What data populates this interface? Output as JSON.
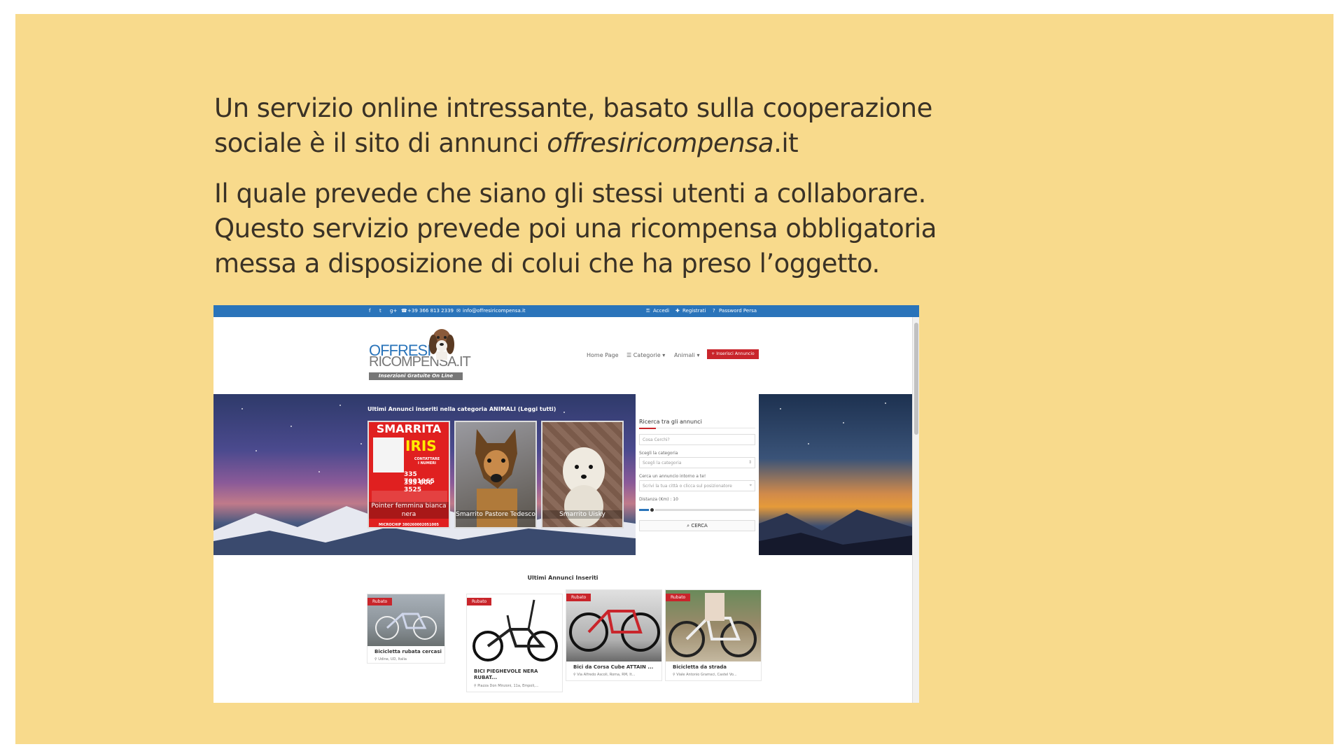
{
  "slide": {
    "p1_line1": "Un servizio online intressante, basato sulla cooperazione",
    "p1_line2_pre": "sociale è il sito di annunci ",
    "p1_line2_em": "offresiricompensa",
    "p1_line2_post": ".it",
    "p2_line1": "Il quale prevede che siano gli stessi utenti a collaborare.",
    "p2_line2": "Questo servizio prevede poi una ricompensa obbligatoria",
    "p2_line3": "messa a disposizione di colui che ha preso l’oggetto."
  },
  "site": {
    "topbar": {
      "social": [
        "f",
        "t",
        "g+"
      ],
      "phone": "+39 366 813 2339",
      "email": "info@offresiricompensa.it",
      "login": "Accedi",
      "register": "Registrati",
      "password": "Password Persa"
    },
    "logo": {
      "line1": "OFFRESI",
      "line2": "RICOMPENSA.IT",
      "tagline": "Inserzioni Gratuite On Line"
    },
    "nav": {
      "home": "Home Page",
      "categories": "Categorie",
      "animals": "Animali",
      "insert": "+ Inserisci Annuncio"
    },
    "hero": {
      "title": "Ultimi Annunci inseriti nella categoria ANIMALI (Leggi tutti)",
      "poster": {
        "title1": "SMARRITA",
        "title2": "IRIS",
        "contact1": "CONTATTARE",
        "contact2": "I NUMERI",
        "phone1": "335 7001965",
        "phone2": "335 806 3525",
        "chip": "MICROCHIP 380260002051005"
      },
      "cards": [
        "Pointer femmina bianca nera",
        "Smarrito Pastore Tedesco",
        "Smarrito Uisky"
      ]
    },
    "search": {
      "title": "Ricerca tra gli annunci",
      "what_placeholder": "Cosa Cerchi?",
      "cat_label": "Scegli la categoria",
      "cat_value": "Scegli la categoria",
      "near_label": "Cerca un annuncio intorno a te!",
      "near_placeholder": "Scrivi la tua città o clicca sul posizionatore",
      "distance_label": "Distanza (Km) : 10",
      "distance_value": 10,
      "button": "CERCA"
    },
    "latest": {
      "title": "Ultimi Annunci Inseriti",
      "items": [
        {
          "tag": "Rubato",
          "title": "Bicicletta rubata cercasi",
          "title2": "",
          "loc": "Udine, UD, Italia"
        },
        {
          "tag": "Rubato",
          "title": "BICI PIEGHEVOLE NERA",
          "title2": "RUBAT...",
          "loc": "Piazza Don Minzoni, 11a, Empoli,..."
        },
        {
          "tag": "Rubato",
          "title": "Bici da Corsa Cube ATTAIN ...",
          "title2": "",
          "loc": "Via Alfredo Ascoli, Roma, RM, It..."
        },
        {
          "tag": "Rubato",
          "title": "Bicicletta da strada",
          "title2": "",
          "loc": "Viale Antonio Gramsci, Castel Vo..."
        }
      ]
    }
  }
}
